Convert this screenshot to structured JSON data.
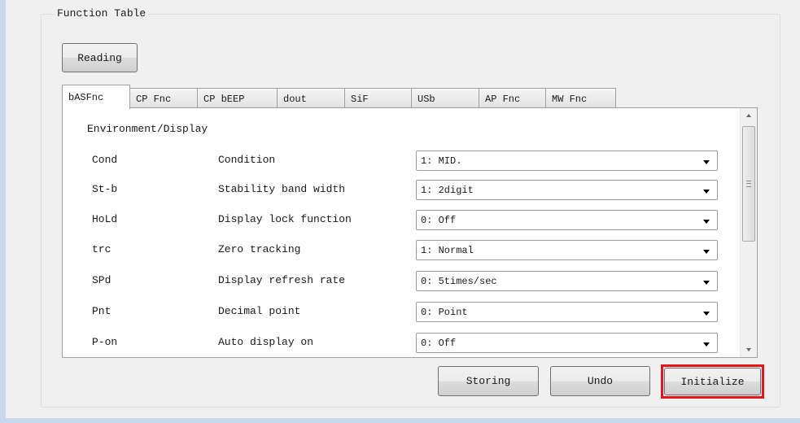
{
  "group_title": "Function Table",
  "buttons": {
    "reading": "Reading",
    "storing": "Storing",
    "undo": "Undo",
    "initialize": "Initialize"
  },
  "tabs": [
    "bASFnc",
    "CP Fnc",
    "CP bEEP",
    "dout",
    "SiF",
    "USb",
    "AP Fnc",
    "MW Fnc"
  ],
  "active_tab": "bASFnc",
  "section_title": "Environment/Display",
  "rows": [
    {
      "code": "Cond",
      "desc": "Condition",
      "value": "1: MID."
    },
    {
      "code": "St-b",
      "desc": "Stability band width",
      "value": "1: 2digit"
    },
    {
      "code": "HoLd",
      "desc": "Display lock function",
      "value": "0: Off"
    },
    {
      "code": "trc",
      "desc": "Zero tracking",
      "value": "1: Normal"
    },
    {
      "code": "SPd",
      "desc": "Display refresh rate",
      "value": "0: 5times/sec"
    },
    {
      "code": "Pnt",
      "desc": "Decimal point",
      "value": "0: Point"
    },
    {
      "code": "P-on",
      "desc": "Auto display on",
      "value": "0: Off"
    }
  ],
  "highlight_color": "#e8141b"
}
